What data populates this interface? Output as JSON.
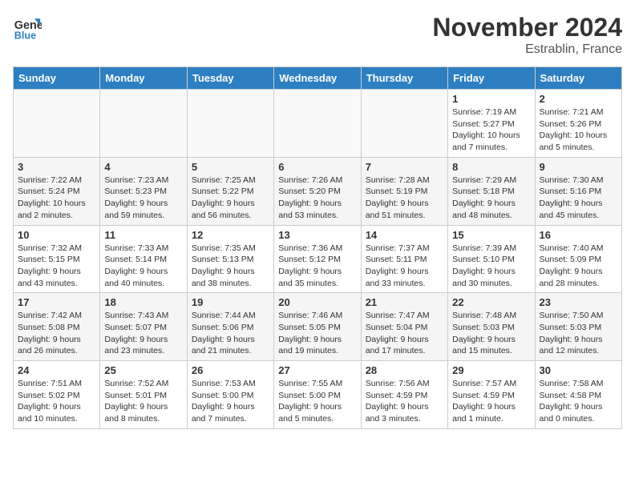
{
  "header": {
    "logo_line1": "General",
    "logo_line2": "Blue",
    "month_title": "November 2024",
    "location": "Estrablin, France"
  },
  "days_of_week": [
    "Sunday",
    "Monday",
    "Tuesday",
    "Wednesday",
    "Thursday",
    "Friday",
    "Saturday"
  ],
  "weeks": [
    [
      {
        "num": "",
        "info": ""
      },
      {
        "num": "",
        "info": ""
      },
      {
        "num": "",
        "info": ""
      },
      {
        "num": "",
        "info": ""
      },
      {
        "num": "",
        "info": ""
      },
      {
        "num": "1",
        "info": "Sunrise: 7:19 AM\nSunset: 5:27 PM\nDaylight: 10 hours and 7 minutes."
      },
      {
        "num": "2",
        "info": "Sunrise: 7:21 AM\nSunset: 5:26 PM\nDaylight: 10 hours and 5 minutes."
      }
    ],
    [
      {
        "num": "3",
        "info": "Sunrise: 7:22 AM\nSunset: 5:24 PM\nDaylight: 10 hours and 2 minutes."
      },
      {
        "num": "4",
        "info": "Sunrise: 7:23 AM\nSunset: 5:23 PM\nDaylight: 9 hours and 59 minutes."
      },
      {
        "num": "5",
        "info": "Sunrise: 7:25 AM\nSunset: 5:22 PM\nDaylight: 9 hours and 56 minutes."
      },
      {
        "num": "6",
        "info": "Sunrise: 7:26 AM\nSunset: 5:20 PM\nDaylight: 9 hours and 53 minutes."
      },
      {
        "num": "7",
        "info": "Sunrise: 7:28 AM\nSunset: 5:19 PM\nDaylight: 9 hours and 51 minutes."
      },
      {
        "num": "8",
        "info": "Sunrise: 7:29 AM\nSunset: 5:18 PM\nDaylight: 9 hours and 48 minutes."
      },
      {
        "num": "9",
        "info": "Sunrise: 7:30 AM\nSunset: 5:16 PM\nDaylight: 9 hours and 45 minutes."
      }
    ],
    [
      {
        "num": "10",
        "info": "Sunrise: 7:32 AM\nSunset: 5:15 PM\nDaylight: 9 hours and 43 minutes."
      },
      {
        "num": "11",
        "info": "Sunrise: 7:33 AM\nSunset: 5:14 PM\nDaylight: 9 hours and 40 minutes."
      },
      {
        "num": "12",
        "info": "Sunrise: 7:35 AM\nSunset: 5:13 PM\nDaylight: 9 hours and 38 minutes."
      },
      {
        "num": "13",
        "info": "Sunrise: 7:36 AM\nSunset: 5:12 PM\nDaylight: 9 hours and 35 minutes."
      },
      {
        "num": "14",
        "info": "Sunrise: 7:37 AM\nSunset: 5:11 PM\nDaylight: 9 hours and 33 minutes."
      },
      {
        "num": "15",
        "info": "Sunrise: 7:39 AM\nSunset: 5:10 PM\nDaylight: 9 hours and 30 minutes."
      },
      {
        "num": "16",
        "info": "Sunrise: 7:40 AM\nSunset: 5:09 PM\nDaylight: 9 hours and 28 minutes."
      }
    ],
    [
      {
        "num": "17",
        "info": "Sunrise: 7:42 AM\nSunset: 5:08 PM\nDaylight: 9 hours and 26 minutes."
      },
      {
        "num": "18",
        "info": "Sunrise: 7:43 AM\nSunset: 5:07 PM\nDaylight: 9 hours and 23 minutes."
      },
      {
        "num": "19",
        "info": "Sunrise: 7:44 AM\nSunset: 5:06 PM\nDaylight: 9 hours and 21 minutes."
      },
      {
        "num": "20",
        "info": "Sunrise: 7:46 AM\nSunset: 5:05 PM\nDaylight: 9 hours and 19 minutes."
      },
      {
        "num": "21",
        "info": "Sunrise: 7:47 AM\nSunset: 5:04 PM\nDaylight: 9 hours and 17 minutes."
      },
      {
        "num": "22",
        "info": "Sunrise: 7:48 AM\nSunset: 5:03 PM\nDaylight: 9 hours and 15 minutes."
      },
      {
        "num": "23",
        "info": "Sunrise: 7:50 AM\nSunset: 5:03 PM\nDaylight: 9 hours and 12 minutes."
      }
    ],
    [
      {
        "num": "24",
        "info": "Sunrise: 7:51 AM\nSunset: 5:02 PM\nDaylight: 9 hours and 10 minutes."
      },
      {
        "num": "25",
        "info": "Sunrise: 7:52 AM\nSunset: 5:01 PM\nDaylight: 9 hours and 8 minutes."
      },
      {
        "num": "26",
        "info": "Sunrise: 7:53 AM\nSunset: 5:00 PM\nDaylight: 9 hours and 7 minutes."
      },
      {
        "num": "27",
        "info": "Sunrise: 7:55 AM\nSunset: 5:00 PM\nDaylight: 9 hours and 5 minutes."
      },
      {
        "num": "28",
        "info": "Sunrise: 7:56 AM\nSunset: 4:59 PM\nDaylight: 9 hours and 3 minutes."
      },
      {
        "num": "29",
        "info": "Sunrise: 7:57 AM\nSunset: 4:59 PM\nDaylight: 9 hours and 1 minute."
      },
      {
        "num": "30",
        "info": "Sunrise: 7:58 AM\nSunset: 4:58 PM\nDaylight: 9 hours and 0 minutes."
      }
    ]
  ]
}
